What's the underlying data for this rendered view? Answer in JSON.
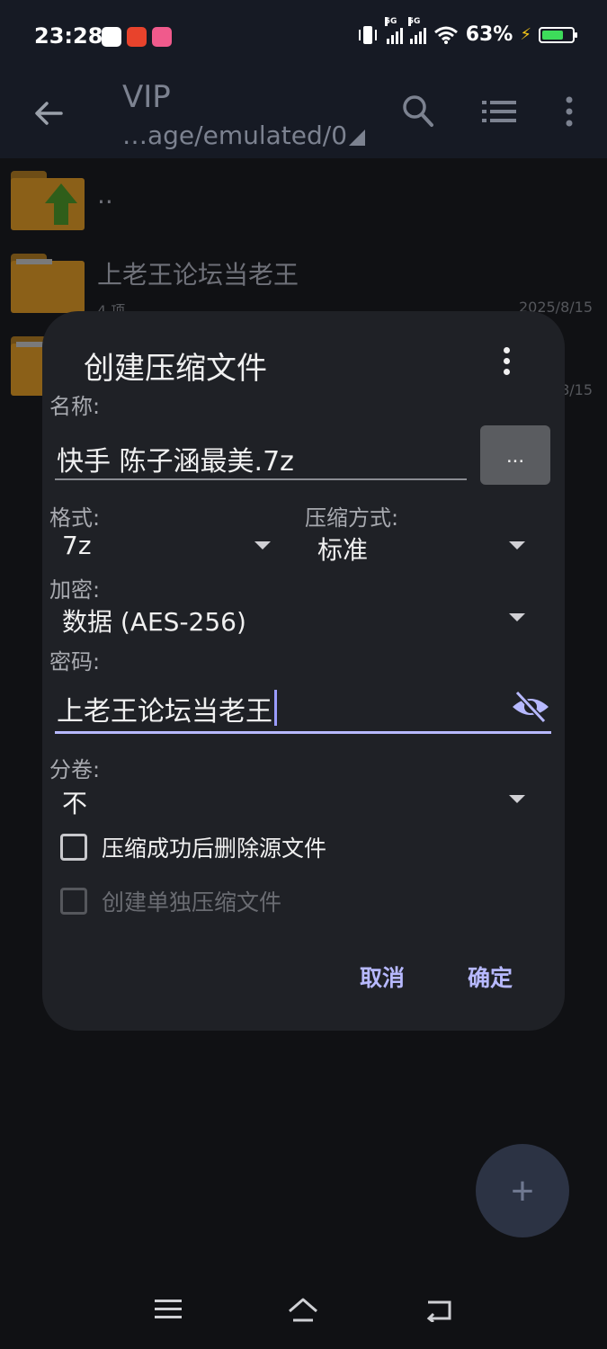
{
  "status_bar": {
    "time": "23:28",
    "network_5g_1": "5G",
    "network_5g_2": "5G",
    "battery": "63%"
  },
  "toolbar": {
    "title": "VIP",
    "path": "…age/emulated/0"
  },
  "files": [
    {
      "name": "..",
      "meta": "",
      "date": ""
    },
    {
      "name": "上老王论坛当老王",
      "meta": "4 项",
      "date": "2025/8/15"
    },
    {
      "name": "",
      "meta": "",
      "date": "8/15"
    }
  ],
  "dialog": {
    "title": "创建压缩文件",
    "name_label": "名称:",
    "name_value": "快手  陈子涵最美.7z",
    "browse_label": "...",
    "format_label": "格式:",
    "format_value": "7z",
    "method_label": "压缩方式:",
    "method_value": "标准",
    "encrypt_label": "加密:",
    "encrypt_value": "数据 (AES-256)",
    "password_label": "密码:",
    "password_value": "上老王论坛当老王",
    "split_label": "分卷:",
    "split_value": "不",
    "delete_source_label": "压缩成功后删除源文件",
    "separate_archives_label": "创建单独压缩文件",
    "cancel_label": "取消",
    "ok_label": "确定"
  },
  "fab": {
    "label": "+"
  },
  "colors": {
    "accent": "#b7b9ff",
    "dialog_bg": "#1f2126",
    "folder": "#8b6018",
    "battery_fill": "#3ddc5a"
  }
}
